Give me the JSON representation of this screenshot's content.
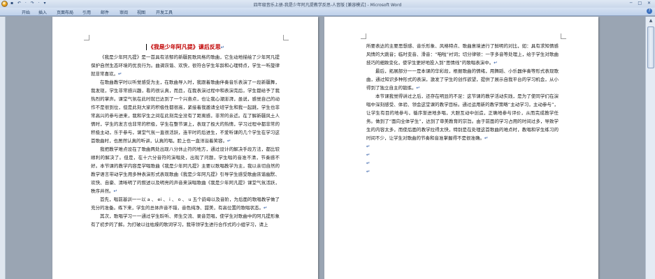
{
  "window": {
    "title": "四年级音乐上册-我是少年阿凡提教学反思-人音版 [兼容模式] - Microsoft Word",
    "qat": "▪ ↶ · ↷ · ▾",
    "controls": "─ □ ✕"
  },
  "ribbon": {
    "tabs": [
      "开始",
      "插入",
      "页面布局",
      "引用",
      "邮件",
      "审阅",
      "视图",
      "开发工具"
    ],
    "help": "?"
  },
  "page1": {
    "heading": "《我是少年阿凡提》课后反思",
    "paragraphs": [
      "《我是少年阿凡提》是一首具有浓郁的新疆民歌风格的歌曲，它生动地描绘了少年阿凡提保护自然生态环境的优良行为。曲调诙谐、欢快，很符合学生年龄和心理特点，学生一听旋律就非常喜欢。",
      "在歌曲教学时以听觉感受为主，在歌曲导入时，我跟着歌曲伴奏音乐表演了一段新疆舞，我发现，学生非常感兴趣，看的很认真，而且，在我表演过程中和表演完后，学生都给予了我热烈的掌声。课堂气氛在此时就已达到了一个兴奋点，也让我心潮澎湃，虽说，感觉自己的动作不是很到位，但是此刻大家的积极性都很高，紧接着我邀请全班学生和我一起跳，学生也非常高兴的参与进来，我和学生之间在此刻完全没有了距离感，非常的亲近。在了解新疆风土人情时，学生的发言也非常的积极，学生在整节课上，表现了极大的热情，学习过程中都非常的积极主动，乐于参与，课堂气氛一直很活跃，连平时的后进生，不爱听课的几个学生在学习这首歌曲时，也居然认真的听讲，认真的唱，脸上也一直洋溢着笑容。",
      "我把教学难点设在了歌曲两处出现八分休止符的地方，通过设计的解决手段方法，都比较顺利的解决了。但是，在十六分音符的演唱处，出现了问题，学生唱的音准不清，节奏感不好。本节课的教学内容是学唱歌曲《我是少年阿凡提》主要以歌唱教学为主，我以亲切自然的教学语言带动学生用多种表演形式表现歌曲《我是少年阿凡提》引导学生感受歌曲诙谐幽默、欢快、自豪、清晰明了的叙述以及明亮的声音来演唱歌曲《我是少年阿凡提》课堂气氛活跃，秩序井然。",
      "首先，唱前基训一一以 a 、 ei 、 i 、 o 、 u 五个韵母以及音阶，为后面的歌唱教学做了充分的准备。练下来，学生的总体声音不错，音色纯净、甜美，有高位置的歌唱状态。",
      "其次，歌唱学习一一通过学生聆听、师生交流、录音范唱，使学生对歌曲中的阿凡提形象有了初步的了解。为打破以往枯燥的歌词学习，我带领学生进行合作式的小组学习，请上"
    ]
  },
  "page2": {
    "paragraphs": [
      "所要表达的主要思想感、音乐形象、风格特点、歌曲意境进行了鲜明的对比，如：具有求知情感风情的大跳音；临时变音、滑音：“咱啦”衬词；切分律顿：一字多音等处理上，给于学生对歌曲技巧的细致变化，使学生更好地投入到“思情线”的歌唱表演中。",
      "最后，拓展部分一一是本课的华彩段，根据歌曲的情绪，用舞蹈、小乐器伴奏等形式表现歌曲，通过知识多种形式的表演，激发了学生的创作欲望，提供了展示自我平台的学习机会，从小得到了独立自主的锻炼。",
      "本节课我觉得讲过之后，还存在明显的不足：这节课的教学活动实践，是为了使同学们在演唱中深刻感受、体验、领会这堂课的教学目标。通过运用新的教学策略“主动学习，主动参与”，让学生有目的地参与，循序渐进地多唱，大胆互动中创造，正确地参与评价，从而完成教学任务。做到了“面向全体学生”，达到了审美教育的宗旨。由于前面的学习占用的时间过多，导致学生的内容太多，而使后面的教学拉得太快，特别是在处理这首歌曲的难点时，教唱和学生练习的时间不少，让学生对歌曲的节奏和音准掌握得不是很准确。"
    ],
    "trailing_marks": [
      "↵",
      "↵",
      "↵",
      "↵"
    ]
  },
  "mark": "↵"
}
